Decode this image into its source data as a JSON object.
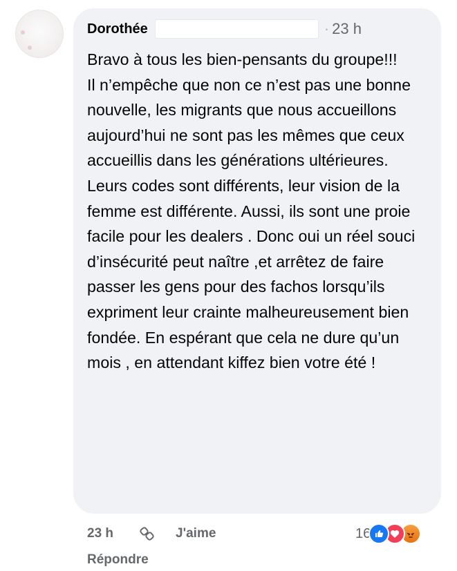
{
  "comment": {
    "author": "Dorothée",
    "timestamp": "23 h",
    "text": "Bravo à tous les bien-pensants du groupe!!!\nIl n’empêche que non ce n’est pas une bonne nouvelle, les migrants que nous accueillons aujourd’hui ne sont pas les mêmes  que ceux accueillis dans les générations ultérieures. Leurs codes sont différents, leur vision de la femme est différente. Aussi, ils sont une proie facile pour les dealers . Donc oui un réel souci d’insécurité peut naître ,et arrêtez de faire passer les gens pour des fachos lorsqu’ils expriment leur crainte malheureusement bien fondée. En espérant que cela ne dure qu’un mois , en attendant kiffez bien votre été !"
  },
  "actions": {
    "time": "23 h",
    "like_label": "J'aime",
    "reply_label": "Répondre"
  },
  "reactions": {
    "count": "16",
    "icons": [
      "like-icon",
      "love-icon",
      "angry-icon"
    ]
  },
  "colors": {
    "bubble": "#f0f2f5",
    "meta_text": "#65676b",
    "like": "#1877f2",
    "love": "#f33e58",
    "angry": "#e9710f"
  }
}
